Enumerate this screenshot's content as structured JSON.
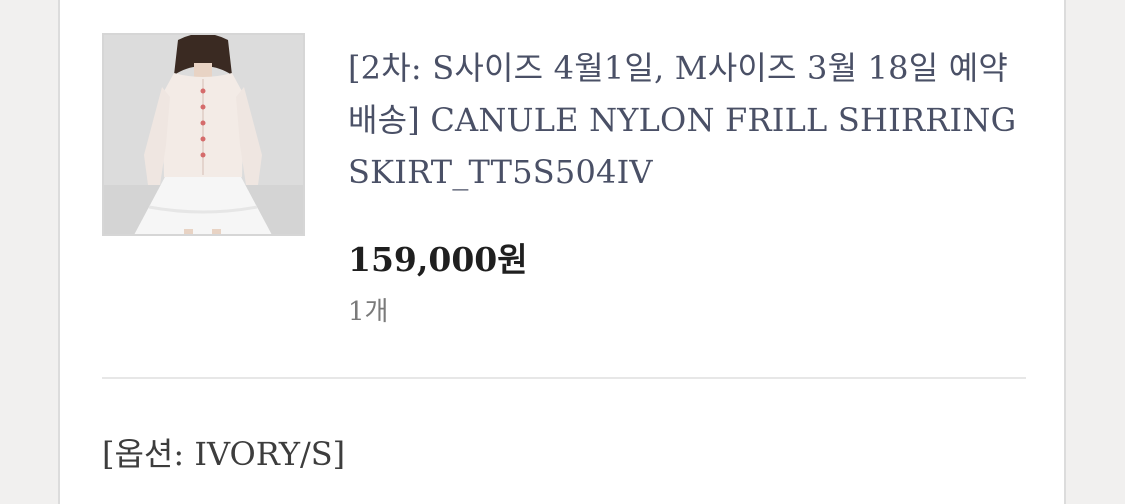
{
  "order_item": {
    "image_icon": "product-photo-model-white-cardigan-skirt",
    "title": "[2차: S사이즈 4월1일, M사이즈 3월 18일 예약배송] CANULE NYLON FRILL SHIRRING SKIRT_TT5S504IV",
    "price": "159,000원",
    "quantity": "1개",
    "option": "[옵션: IVORY/S]"
  },
  "colors": {
    "background": "#f1f0ef",
    "card": "#ffffff",
    "title_text": "#4a5066",
    "price_text": "#1f1f1f",
    "muted_text": "#7a7a7a"
  }
}
